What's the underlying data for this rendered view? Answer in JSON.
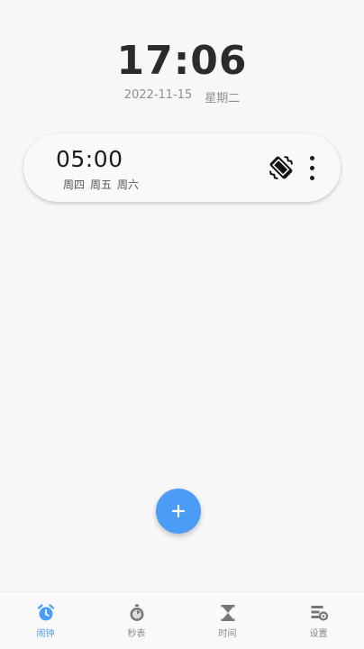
{
  "clock": {
    "time": "17:06",
    "date": "2022-11-15",
    "weekday": "星期二"
  },
  "alarms": [
    {
      "time": "05:00",
      "days": [
        "周四",
        "周五",
        "周六"
      ],
      "vibrate_icon": "vibrate-icon",
      "more_icon": "more-vertical-icon"
    }
  ],
  "fab": {
    "label": "+",
    "icon": "add-icon"
  },
  "nav": [
    {
      "label": "闹钟",
      "icon": "alarm-clock-icon",
      "active": true
    },
    {
      "label": "秒表",
      "icon": "stopwatch-icon",
      "active": false
    },
    {
      "label": "时间",
      "icon": "hourglass-icon",
      "active": false
    },
    {
      "label": "设置",
      "icon": "settings-icon",
      "active": false
    }
  ],
  "colors": {
    "accent": "#4b9cf6",
    "background": "#f7f7f7",
    "inactive": "#888888"
  }
}
